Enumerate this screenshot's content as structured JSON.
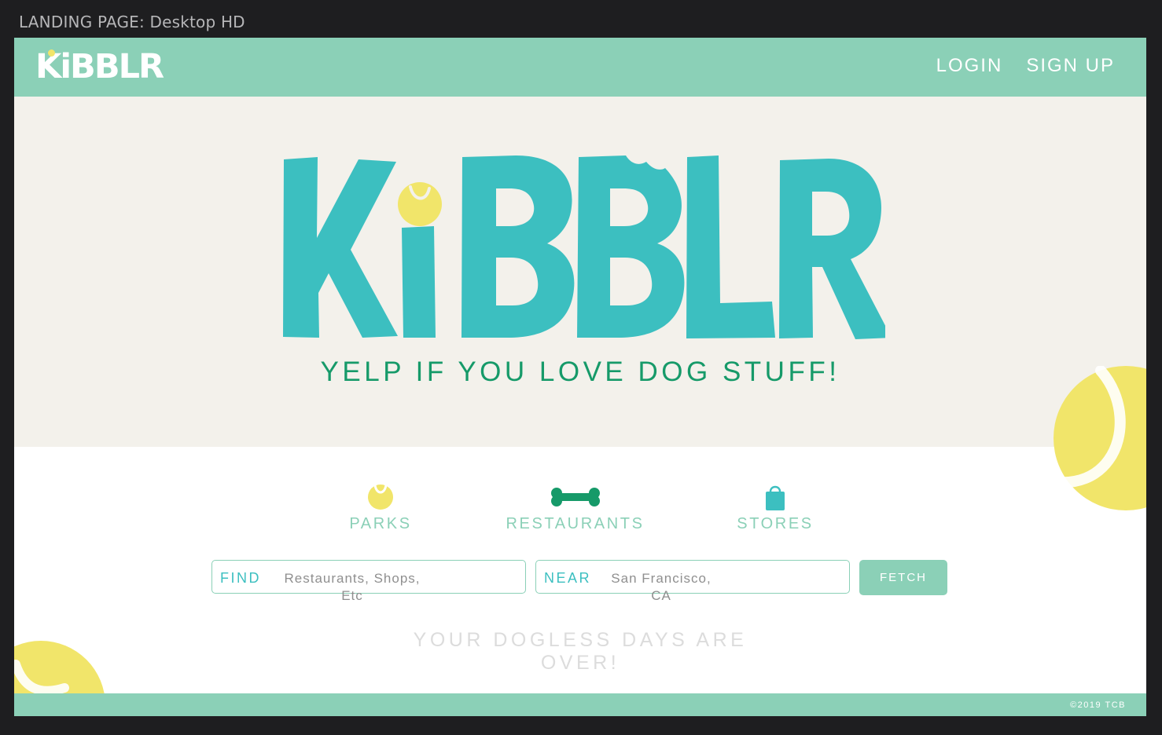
{
  "frame": {
    "label": "LANDING PAGE: Desktop HD"
  },
  "header": {
    "logo_text": "KiBBLR",
    "nav": {
      "login": "LOGIN",
      "signup": "SIGN UP"
    }
  },
  "hero": {
    "logo_text": "KiBBLR",
    "tagline": "YELP IF YOU LOVE DOG STUFF!"
  },
  "categories": [
    {
      "label": "PARKS",
      "icon": "tennis-ball-icon"
    },
    {
      "label": "RESTAURANTS",
      "icon": "bone-icon"
    },
    {
      "label": "STORES",
      "icon": "shopping-bag-icon"
    }
  ],
  "search": {
    "find_label": "FIND",
    "find_placeholder": "Restaurants, Shops, Etc",
    "near_label": "NEAR",
    "near_placeholder": "San Francisco, CA",
    "button_label": "FETCH"
  },
  "tagline2": "YOUR DOGLESS DAYS ARE OVER!",
  "footer": {
    "copyright": "©2019 TCB"
  },
  "colors": {
    "mint": "#8bd0b7",
    "teal": "#3cbfc0",
    "green": "#169a69",
    "cream": "#f3f1eb",
    "ball_yellow": "#f1e56a",
    "light_grey_text": "#dcdcdc",
    "frame_background": "#1e1e20"
  }
}
